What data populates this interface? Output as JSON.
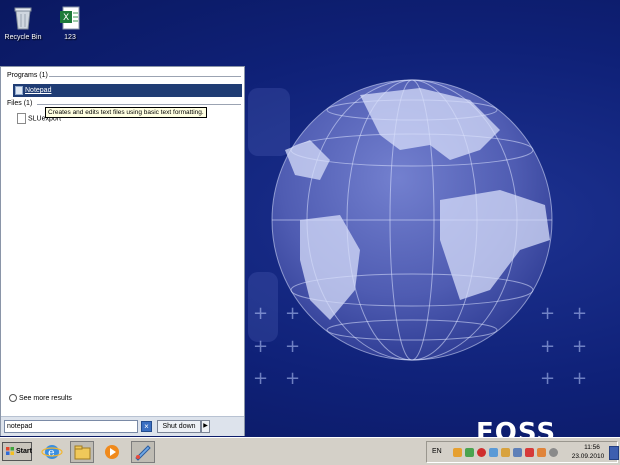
{
  "desktop": {
    "icons": [
      {
        "label": "Recycle Bin",
        "icon": "recycle-bin-icon"
      },
      {
        "label": "123",
        "icon": "excel-file-icon"
      }
    ],
    "brand_text": "EOSS",
    "colors": {
      "background": "#0f2178",
      "globe": "#5d6cc0"
    }
  },
  "start_menu": {
    "programs_header": "Programs (1)",
    "programs": [
      {
        "label": "Notepad",
        "icon": "notepad-icon"
      }
    ],
    "tooltip": "Creates and edits text files using basic text formatting.",
    "files_header": "Files (1)",
    "files": [
      {
        "label": "SLUexport",
        "icon": "text-file-icon"
      }
    ],
    "see_more": "See more results",
    "search": {
      "value": "notepad",
      "placeholder": ""
    },
    "shutdown_label": "Shut down"
  },
  "taskbar": {
    "start_label": "Start",
    "apps": [
      "internet-explorer-icon",
      "file-explorer-icon",
      "media-player-icon",
      "paint-icon"
    ],
    "language": "EN",
    "clock_time": "11:56",
    "clock_date": "23.09.2010"
  }
}
